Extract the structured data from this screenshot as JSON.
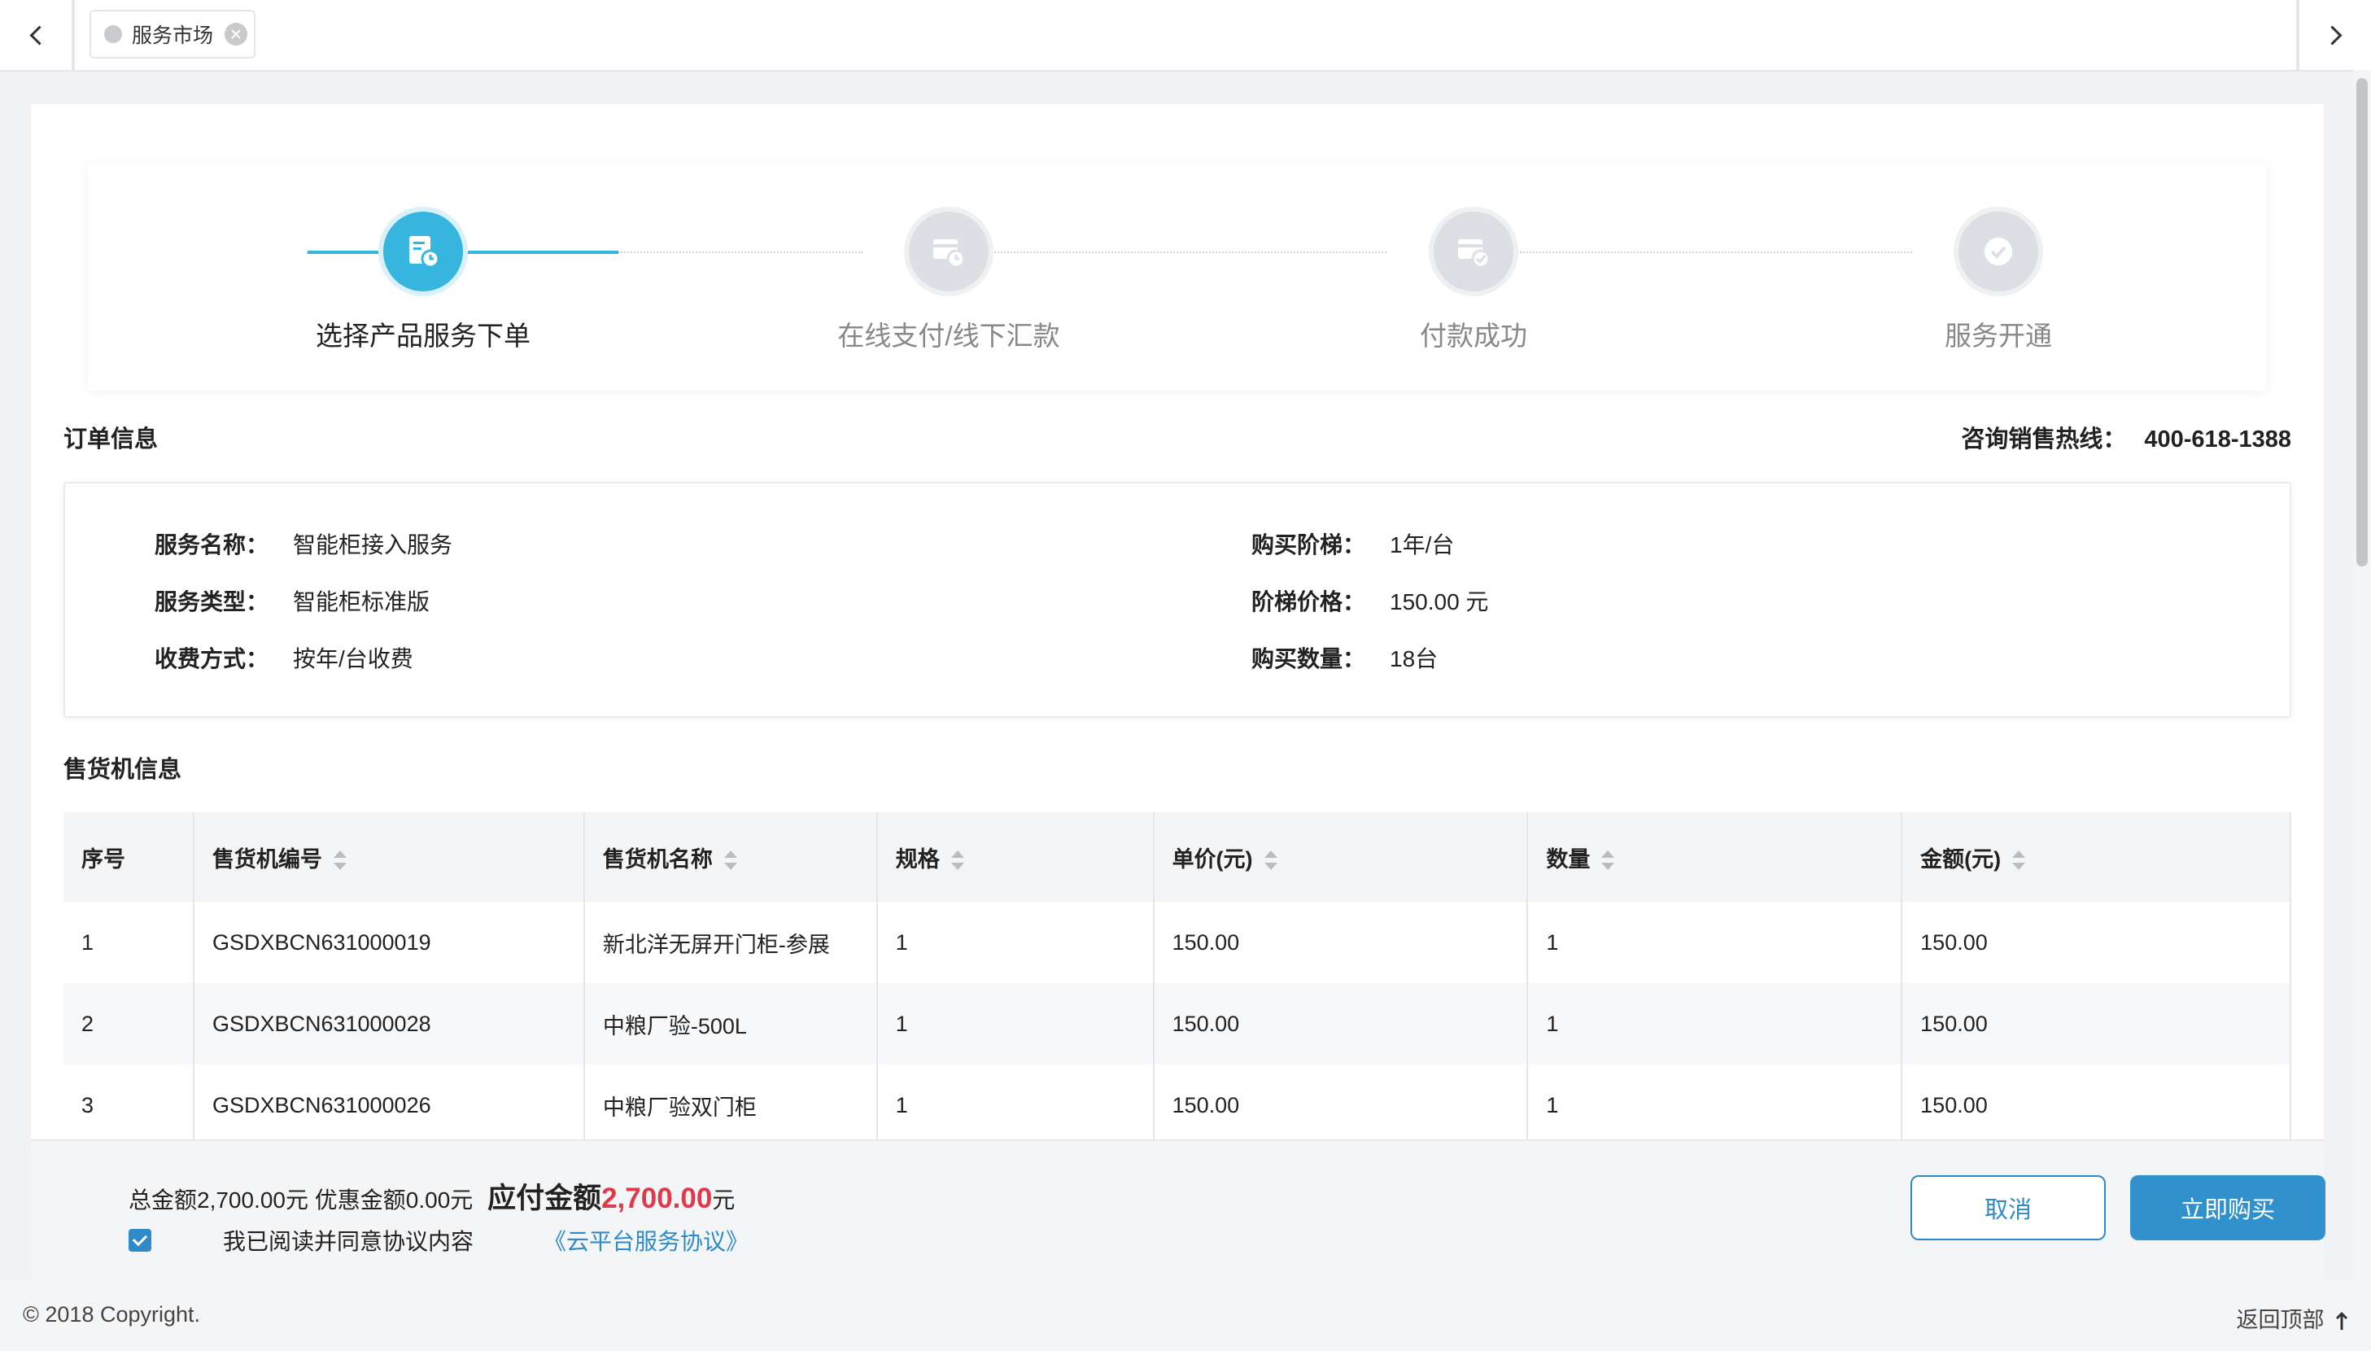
{
  "tabs": [
    {
      "label": "服务市场"
    }
  ],
  "steps": [
    {
      "label": "选择产品服务下单",
      "state": "active"
    },
    {
      "label": "在线支付/线下汇款",
      "state": "todo"
    },
    {
      "label": "付款成功",
      "state": "todo"
    },
    {
      "label": "服务开通",
      "state": "todo"
    }
  ],
  "order": {
    "title": "订单信息",
    "hotline_label": "咨询销售热线：",
    "hotline_number": "400-618-1388",
    "left": [
      {
        "label": "服务名称：",
        "value": "智能柜接入服务"
      },
      {
        "label": "服务类型：",
        "value": "智能柜标准版"
      },
      {
        "label": "收费方式：",
        "value": "按年/台收费"
      }
    ],
    "right": [
      {
        "label": "购买阶梯：",
        "value": "1年/台"
      },
      {
        "label": "阶梯价格：",
        "value": "150.00 元"
      },
      {
        "label": "购买数量：",
        "value": "18台"
      }
    ]
  },
  "machines": {
    "title": "售货机信息",
    "columns": [
      "序号",
      "售货机编号",
      "售货机名称",
      "规格",
      "单价(元)",
      "数量",
      "金额(元)"
    ],
    "rows": [
      [
        "1",
        "GSDXBCN631000019",
        "新北洋无屏开门柜-参展",
        "1",
        "150.00",
        "1",
        "150.00"
      ],
      [
        "2",
        "GSDXBCN631000028",
        "中粮厂验-500L",
        "1",
        "150.00",
        "1",
        "150.00"
      ],
      [
        "3",
        "GSDXBCN631000026",
        "中粮厂验双门柜",
        "1",
        "150.00",
        "1",
        "150.00"
      ]
    ]
  },
  "summary": {
    "total": "总金额2,700.00元",
    "discount": "优惠金额0.00元",
    "pay_label": "应付金额",
    "pay_amount": "2,700.00",
    "pay_unit": "元",
    "agree_text": "我已阅读并同意协议内容",
    "agree_link": "《云平台服务协议》",
    "cancel_label": "取消",
    "buy_label": "立即购买"
  },
  "footer": {
    "copyright": "© 2018 Copyright.",
    "back_top": "返回顶部"
  },
  "colors": {
    "accent": "#36b5de",
    "primary_button": "#3191cd",
    "amount": "#e0394a"
  }
}
